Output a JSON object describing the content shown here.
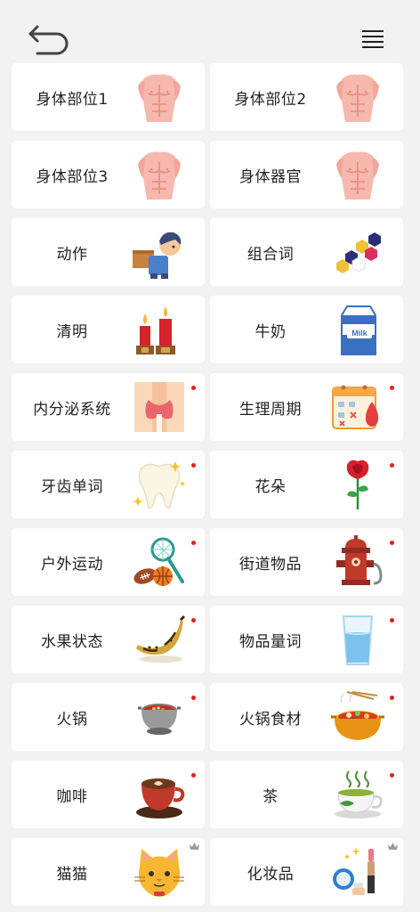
{
  "header": {
    "back_icon": "back-arrow-icon",
    "menu_icon": "hamburger-menu-icon"
  },
  "accent": {
    "dot": "#e81c1c",
    "crown": "#9a9a9a"
  },
  "categories": [
    {
      "label": "身体部位1",
      "icon": "torso-icon",
      "badge": ""
    },
    {
      "label": "身体部位2",
      "icon": "torso-icon",
      "badge": ""
    },
    {
      "label": "身体部位3",
      "icon": "torso-icon",
      "badge": ""
    },
    {
      "label": "身体器官",
      "icon": "torso-icon",
      "badge": ""
    },
    {
      "label": "动作",
      "icon": "delivery-boy-icon",
      "badge": ""
    },
    {
      "label": "组合词",
      "icon": "molecule-icon",
      "badge": ""
    },
    {
      "label": "清明",
      "icon": "candles-icon",
      "badge": ""
    },
    {
      "label": "牛奶",
      "icon": "milk-carton-icon",
      "badge": ""
    },
    {
      "label": "内分泌系统",
      "icon": "thyroid-icon",
      "badge": "dot"
    },
    {
      "label": "生理周期",
      "icon": "period-calendar-icon",
      "badge": "dot"
    },
    {
      "label": "牙齿单词",
      "icon": "tooth-icon",
      "badge": "dot"
    },
    {
      "label": "花朵",
      "icon": "rose-icon",
      "badge": "dot"
    },
    {
      "label": "户外运动",
      "icon": "sports-balls-icon",
      "badge": "dot"
    },
    {
      "label": "街道物品",
      "icon": "fire-hydrant-icon",
      "badge": "dot"
    },
    {
      "label": "水果状态",
      "icon": "banana-icon",
      "badge": "dot"
    },
    {
      "label": "物品量词",
      "icon": "water-glass-icon",
      "badge": "dot"
    },
    {
      "label": "火锅",
      "icon": "hotpot-icon",
      "badge": "dot"
    },
    {
      "label": "火锅食材",
      "icon": "hotpot-ingredients-icon",
      "badge": "dot"
    },
    {
      "label": "咖啡",
      "icon": "coffee-cup-icon",
      "badge": "dot"
    },
    {
      "label": "茶",
      "icon": "tea-cup-icon",
      "badge": "dot"
    },
    {
      "label": "猫猫",
      "icon": "cat-face-icon",
      "badge": "crown"
    },
    {
      "label": "化妆品",
      "icon": "cosmetics-icon",
      "badge": "crown"
    }
  ]
}
